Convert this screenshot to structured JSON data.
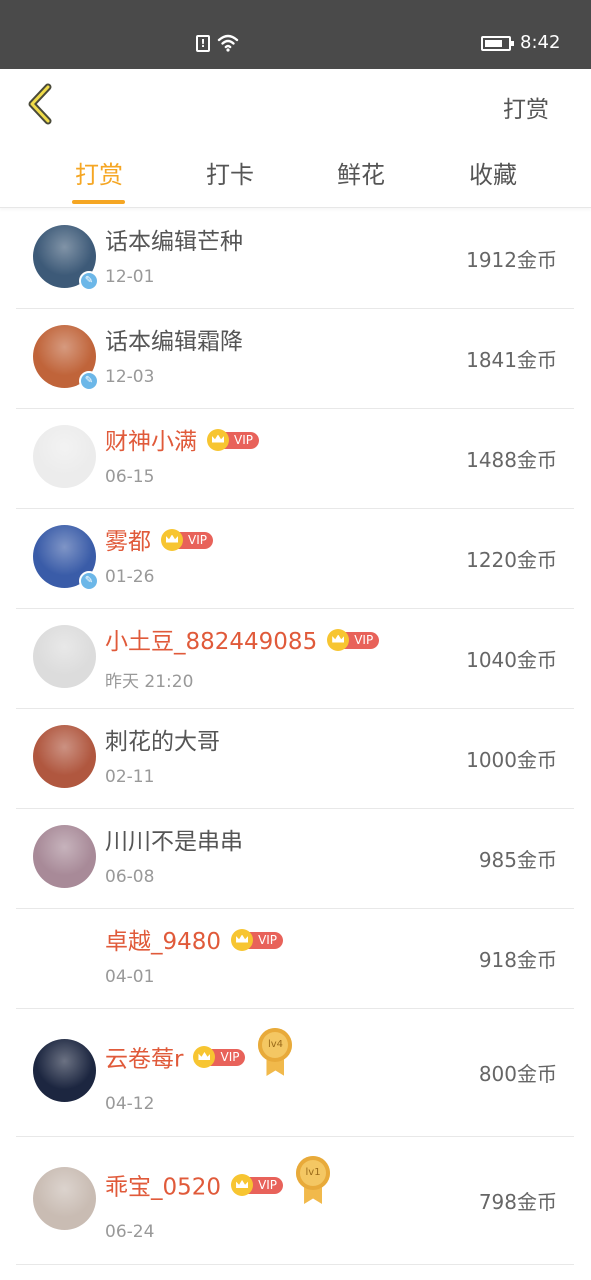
{
  "status_bar": {
    "time": "8:42",
    "sim_icon": "sim-alert-icon",
    "wifi_icon": "wifi-icon",
    "battery_level": 0.75
  },
  "header": {
    "back_icon": "chevron-left-icon",
    "title": "打赏"
  },
  "tabs": [
    {
      "label": "打赏",
      "active": true
    },
    {
      "label": "打卡",
      "active": false
    },
    {
      "label": "鲜花",
      "active": false
    },
    {
      "label": "收藏",
      "active": false
    }
  ],
  "colors": {
    "accent": "#f5a623",
    "vip_name": "#e05a3a",
    "vip_tag": "#e8625a",
    "crown": "#f7c531",
    "author_badge": "#6cb7e8",
    "status_bar": "#4a4a4a"
  },
  "rewards": [
    {
      "name": "话本编辑芒种",
      "date": "12-01",
      "amount": "1912金币",
      "vip": false,
      "author_badge": true,
      "medal": null,
      "avatar_color": "#3d5a78"
    },
    {
      "name": "话本编辑霜降",
      "date": "12-03",
      "amount": "1841金币",
      "vip": false,
      "author_badge": true,
      "medal": null,
      "avatar_color": "#c0643a"
    },
    {
      "name": "财神小满",
      "date": "06-15",
      "amount": "1488金币",
      "vip": true,
      "vip_label": "VIP",
      "author_badge": false,
      "medal": null,
      "avatar_color": "#ececec"
    },
    {
      "name": "雾都",
      "date": "01-26",
      "amount": "1220金币",
      "vip": true,
      "vip_label": "VIP",
      "author_badge": true,
      "medal": null,
      "avatar_color": "#3a5ca8"
    },
    {
      "name": "小土豆_882449085",
      "date": "昨天 21:20",
      "amount": "1040金币",
      "vip": true,
      "vip_label": "VIP",
      "author_badge": false,
      "medal": null,
      "avatar_color": "#dcdcdc"
    },
    {
      "name": "刺花的大哥",
      "date": "02-11",
      "amount": "1000金币",
      "vip": false,
      "author_badge": false,
      "medal": null,
      "avatar_color": "#b0573f"
    },
    {
      "name": "川川不是串串",
      "date": "06-08",
      "amount": "985金币",
      "vip": false,
      "author_badge": false,
      "medal": null,
      "avatar_color": "#a88a98"
    },
    {
      "name": "卓越_9480",
      "date": "04-01",
      "amount": "918金币",
      "vip": true,
      "vip_label": "VIP",
      "author_badge": false,
      "medal": null,
      "avatar_color": "#ffffff"
    },
    {
      "name": "云卷莓r",
      "date": "04-12",
      "amount": "800金币",
      "vip": true,
      "vip_label": "VIP",
      "author_badge": false,
      "medal": "lv4",
      "avatar_color": "#1c2640"
    },
    {
      "name": "乖宝_0520",
      "date": "06-24",
      "amount": "798金币",
      "vip": true,
      "vip_label": "VIP",
      "author_badge": false,
      "medal": "lv1",
      "avatar_color": "#c9bcb3"
    }
  ]
}
